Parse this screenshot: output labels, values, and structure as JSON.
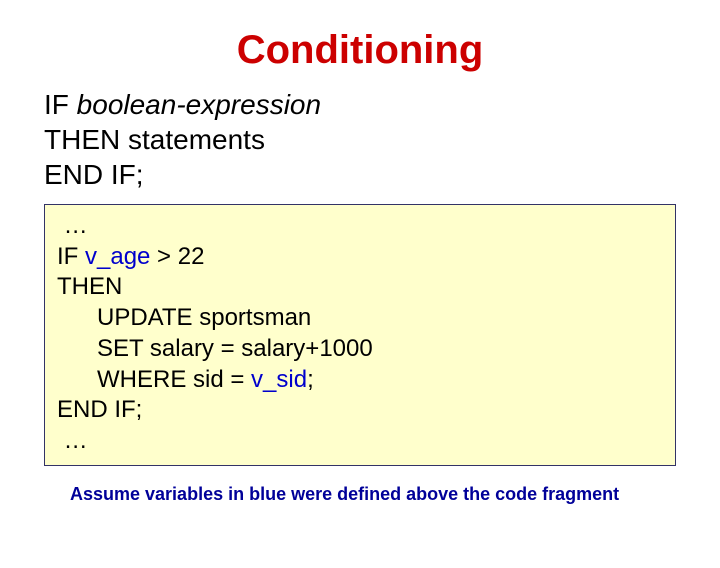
{
  "title": "Conditioning",
  "syntax": {
    "line1_kw": "IF ",
    "line1_expr": "boolean-expression",
    "line2_kw": "THEN ",
    "line2_rest": "statements",
    "line3": "END IF;"
  },
  "code": {
    "l1": " …",
    "l2_a": "IF ",
    "l2_var": "v_age",
    "l2_b": " > 22",
    "l3": "THEN",
    "l4": "UPDATE sportsman",
    "l5": "SET salary = salary+1000",
    "l6_a": "WHERE sid = ",
    "l6_var": "v_sid",
    "l6_b": ";",
    "l7": "END IF;",
    "l8": " …"
  },
  "footnote": "Assume variables in blue were defined above the code fragment"
}
